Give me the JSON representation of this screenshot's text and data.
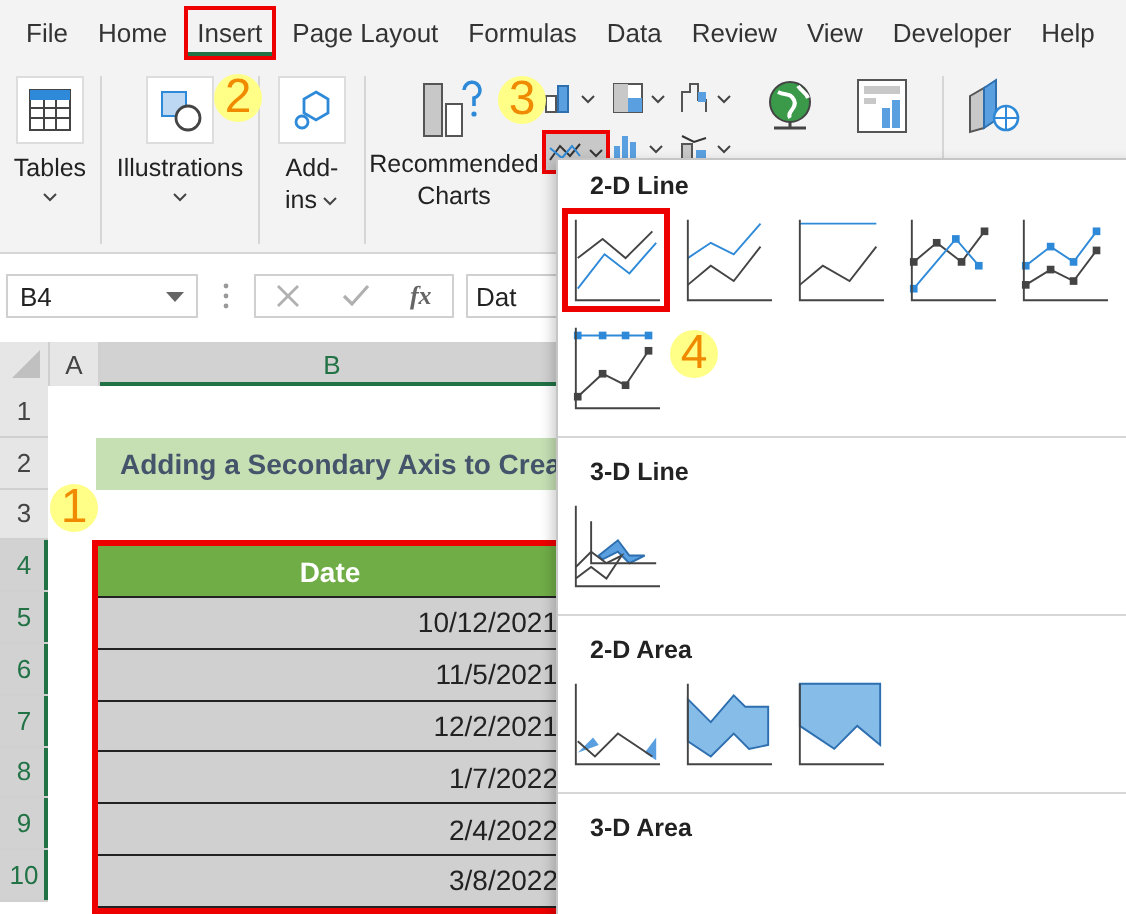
{
  "menu_tabs": [
    {
      "label": "File",
      "selected": false
    },
    {
      "label": "Home",
      "selected": false
    },
    {
      "label": "Insert",
      "selected": true
    },
    {
      "label": "Page Layout",
      "selected": false
    },
    {
      "label": "Formulas",
      "selected": false
    },
    {
      "label": "Data",
      "selected": false
    },
    {
      "label": "Review",
      "selected": false
    },
    {
      "label": "View",
      "selected": false
    },
    {
      "label": "Developer",
      "selected": false
    },
    {
      "label": "Help",
      "selected": false
    }
  ],
  "ribbon": {
    "tables": "Tables",
    "illustrations": "Illustrations",
    "addins": [
      "Add-",
      "ins"
    ],
    "recommended": [
      "Recommended",
      "Charts"
    ],
    "line_button_selected": true
  },
  "formula_bar": {
    "name_box": "B4",
    "fx": "fx",
    "value": "Dat"
  },
  "sheet": {
    "columns": [
      {
        "label": "A",
        "selected": false
      },
      {
        "label": "B",
        "selected": true
      }
    ],
    "rows": [
      {
        "label": "1",
        "selected": false
      },
      {
        "label": "2",
        "selected": false
      },
      {
        "label": "3",
        "selected": false
      },
      {
        "label": "4",
        "selected": true
      },
      {
        "label": "5",
        "selected": true
      },
      {
        "label": "6",
        "selected": true
      },
      {
        "label": "7",
        "selected": true
      },
      {
        "label": "8",
        "selected": true
      },
      {
        "label": "9",
        "selected": true
      },
      {
        "label": "10",
        "selected": true
      }
    ],
    "title": "Adding a Secondary Axis to Crea",
    "table": {
      "selected": true,
      "header": "Date",
      "cells": [
        "10/12/2021",
        "11/5/2021",
        "12/2/2021",
        "1/7/2022",
        "2/4/2022",
        "3/8/2022"
      ]
    }
  },
  "dropdown": {
    "sections": [
      {
        "title": "2-D Line",
        "items": [
          {
            "kind": "line",
            "selected": true
          },
          {
            "kind": "stacked-line",
            "selected": false
          },
          {
            "kind": "full-line",
            "selected": false
          },
          {
            "kind": "marker-line",
            "selected": false
          },
          {
            "kind": "stacked-marker-line",
            "selected": false
          },
          {
            "kind": "full-marker-line",
            "selected": false
          }
        ]
      },
      {
        "title": "3-D Line",
        "items": [
          {
            "kind": "line-3d",
            "selected": false
          }
        ]
      },
      {
        "title": "2-D Area",
        "items": [
          {
            "kind": "area",
            "selected": false
          },
          {
            "kind": "stacked-area",
            "selected": false
          },
          {
            "kind": "full-area",
            "selected": false
          }
        ]
      },
      {
        "title": "3-D Area"
      }
    ]
  },
  "annotations": [
    {
      "label": "1"
    },
    {
      "label": "2"
    },
    {
      "label": "3"
    },
    {
      "label": "4"
    }
  ]
}
